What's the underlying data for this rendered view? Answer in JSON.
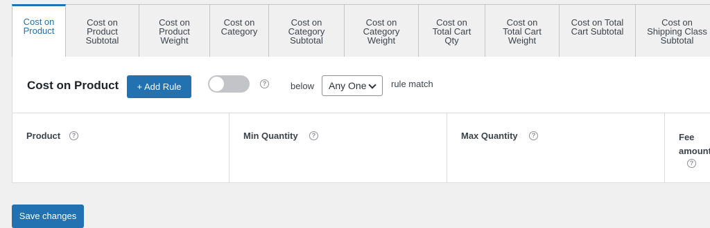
{
  "tabs": [
    {
      "label": "Cost on\nProduct",
      "active": true
    },
    {
      "label": "Cost on\nProduct\nSubtotal",
      "active": false
    },
    {
      "label": "Cost on\nProduct\nWeight",
      "active": false
    },
    {
      "label": "Cost on\nCategory",
      "active": false
    },
    {
      "label": "Cost on\nCategory\nSubtotal",
      "active": false
    },
    {
      "label": "Cost on\nCategory\nWeight",
      "active": false
    },
    {
      "label": "Cost on\nTotal Cart\nQty",
      "active": false
    },
    {
      "label": "Cost on\nTotal Cart\nWeight",
      "active": false
    },
    {
      "label": "Cost on Total\nCart Subtotal",
      "active": false
    },
    {
      "label": "Cost on\nShipping Class\nSubtotal",
      "active": false
    }
  ],
  "panel": {
    "title": "Cost on Product",
    "add_rule_label": "+ Add Rule",
    "toggle_on": false,
    "below_label": "below",
    "match_select_value": "Any One",
    "rule_match_label": "rule match"
  },
  "columns": {
    "product": "Product",
    "min_quantity": "Min Quantity",
    "max_quantity": "Max Quantity",
    "fee_amount_line1": "Fee",
    "fee_amount_line2": "amount"
  },
  "help_glyph": "?",
  "save_label": "Save changes",
  "colors": {
    "accent": "#2271b1",
    "background": "#f0f0f1",
    "border": "#c3c4c7"
  }
}
